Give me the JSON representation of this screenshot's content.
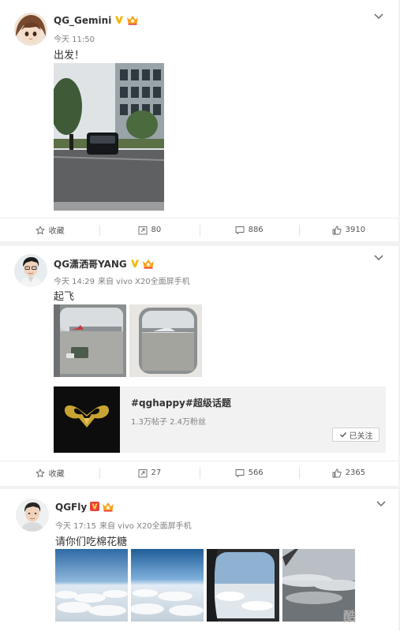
{
  "posts": [
    {
      "username": "QG_Gemini",
      "time": "今天 11:50",
      "source": "",
      "text": "出发！",
      "actions": {
        "favorite": "收藏",
        "repost": "80",
        "comment": "886",
        "like": "3910"
      }
    },
    {
      "username": "QG潇洒哥YANG",
      "time": "今天 14:29",
      "source": "来自 vivo X20全面屏手机",
      "text": "起飞",
      "topic": {
        "title": "#qghappy#超级话题",
        "stats": "1.3万帖子 2.4万粉丝",
        "follow_label": "已关注"
      },
      "actions": {
        "favorite": "收藏",
        "repost": "27",
        "comment": "566",
        "like": "2365"
      }
    },
    {
      "username": "QGFly",
      "time": "今天 17:15",
      "source": "来自 vivo X20全面屏手机",
      "text": "请你们吃棉花糖"
    }
  ],
  "watermark": "酷",
  "colors": {
    "crown": "#f7a31c",
    "vbadge_gold": "#f5b800",
    "vbadge_red": "#e8413a",
    "muted": "#808080"
  },
  "icons": [
    "star-icon",
    "repost-icon",
    "comment-icon",
    "thumbs-up-icon",
    "chevron-down-icon",
    "verified-badge-icon",
    "crown-badge-icon",
    "check-icon"
  ]
}
